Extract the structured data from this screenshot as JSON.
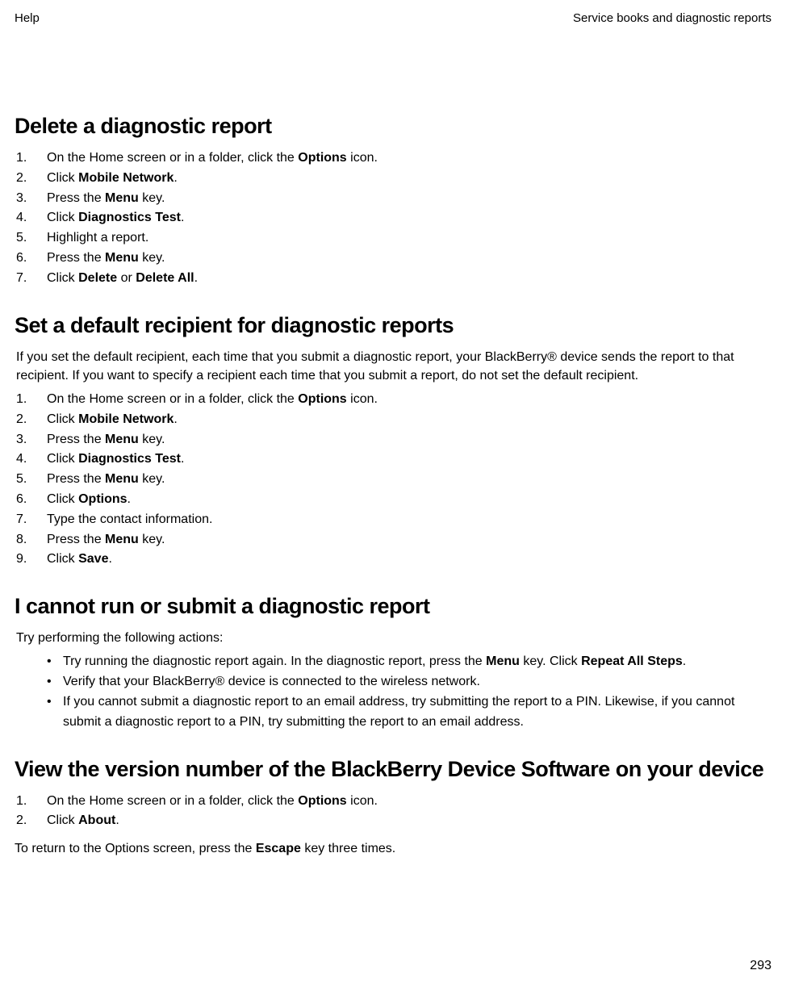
{
  "header": {
    "left": "Help",
    "right": "Service books and diagnostic reports"
  },
  "sections": {
    "delete": {
      "title": "Delete a diagnostic report",
      "s1a": "On the Home screen or in a folder, click the ",
      "s1b": "Options",
      "s1c": " icon.",
      "s2a": "Click ",
      "s2b": "Mobile Network",
      "s2c": ".",
      "s3a": "Press the ",
      "s3b": "Menu",
      "s3c": " key.",
      "s4a": "Click ",
      "s4b": "Diagnostics Test",
      "s4c": ".",
      "s5": "Highlight a report.",
      "s6a": "Press the ",
      "s6b": "Menu",
      "s6c": " key.",
      "s7a": "Click ",
      "s7b": "Delete",
      "s7c": " or ",
      "s7d": "Delete All",
      "s7e": "."
    },
    "recipient": {
      "title": "Set a default recipient for diagnostic reports",
      "intro": "If you set the default recipient, each time that you submit a diagnostic report, your BlackBerry® device sends the report to that recipient. If you want to specify a recipient each time that you submit a report, do not set the default recipient.",
      "s1a": "On the Home screen or in a folder, click the ",
      "s1b": "Options",
      "s1c": " icon.",
      "s2a": "Click ",
      "s2b": "Mobile Network",
      "s2c": ".",
      "s3a": "Press the ",
      "s3b": "Menu",
      "s3c": " key.",
      "s4a": "Click ",
      "s4b": "Diagnostics Test",
      "s4c": ".",
      "s5a": "Press the ",
      "s5b": "Menu",
      "s5c": " key.",
      "s6a": "Click ",
      "s6b": "Options",
      "s6c": ".",
      "s7": "Type the contact information.",
      "s8a": "Press the ",
      "s8b": "Menu",
      "s8c": " key.",
      "s9a": "Click ",
      "s9b": "Save",
      "s9c": "."
    },
    "cannot": {
      "title": "I cannot run or submit a diagnostic report",
      "intro": "Try performing the following actions:",
      "b1a": "Try running the diagnostic report again. In the diagnostic report, press the ",
      "b1b": "Menu",
      "b1c": " key. Click ",
      "b1d": "Repeat All Steps",
      "b1e": ".",
      "b2": "Verify that your BlackBerry® device is connected to the wireless network.",
      "b3": "If you cannot submit a diagnostic report to an email address, try submitting the report to a PIN. Likewise, if you cannot submit a diagnostic report to a PIN, try submitting the report to an email address."
    },
    "version": {
      "title": "View the version number of the BlackBerry Device Software on your device",
      "s1a": "On the Home screen or in a folder, click the ",
      "s1b": "Options",
      "s1c": " icon.",
      "s2a": "Click ",
      "s2b": "About",
      "s2c": ".",
      "tail_a": "To return to the Options screen, press the ",
      "tail_b": "Escape",
      "tail_c": " key three times."
    }
  },
  "page_number": "293"
}
